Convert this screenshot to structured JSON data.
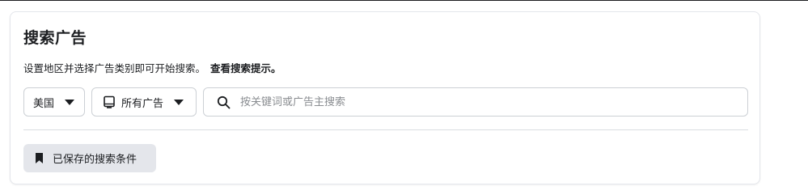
{
  "header": {
    "title": "搜索广告",
    "subtitle": "设置地区并选择广告类别即可开始搜索。",
    "tips_link": "查看搜索提示。"
  },
  "filters": {
    "country": {
      "value": "美国",
      "icon": "chevron-down-icon"
    },
    "ad_type": {
      "icon": "device-icon",
      "value": "所有广告",
      "caret_icon": "chevron-down-icon"
    }
  },
  "search": {
    "icon": "search-icon",
    "placeholder": "按关键词或广告主搜索",
    "value": ""
  },
  "saved_searches": {
    "icon": "bookmark-icon",
    "label": "已保存的搜索条件"
  },
  "colors": {
    "text": "#1c1e21",
    "border": "#ccd0d5",
    "placeholder": "#8a8d91",
    "button_bg": "#e4e6eb"
  }
}
